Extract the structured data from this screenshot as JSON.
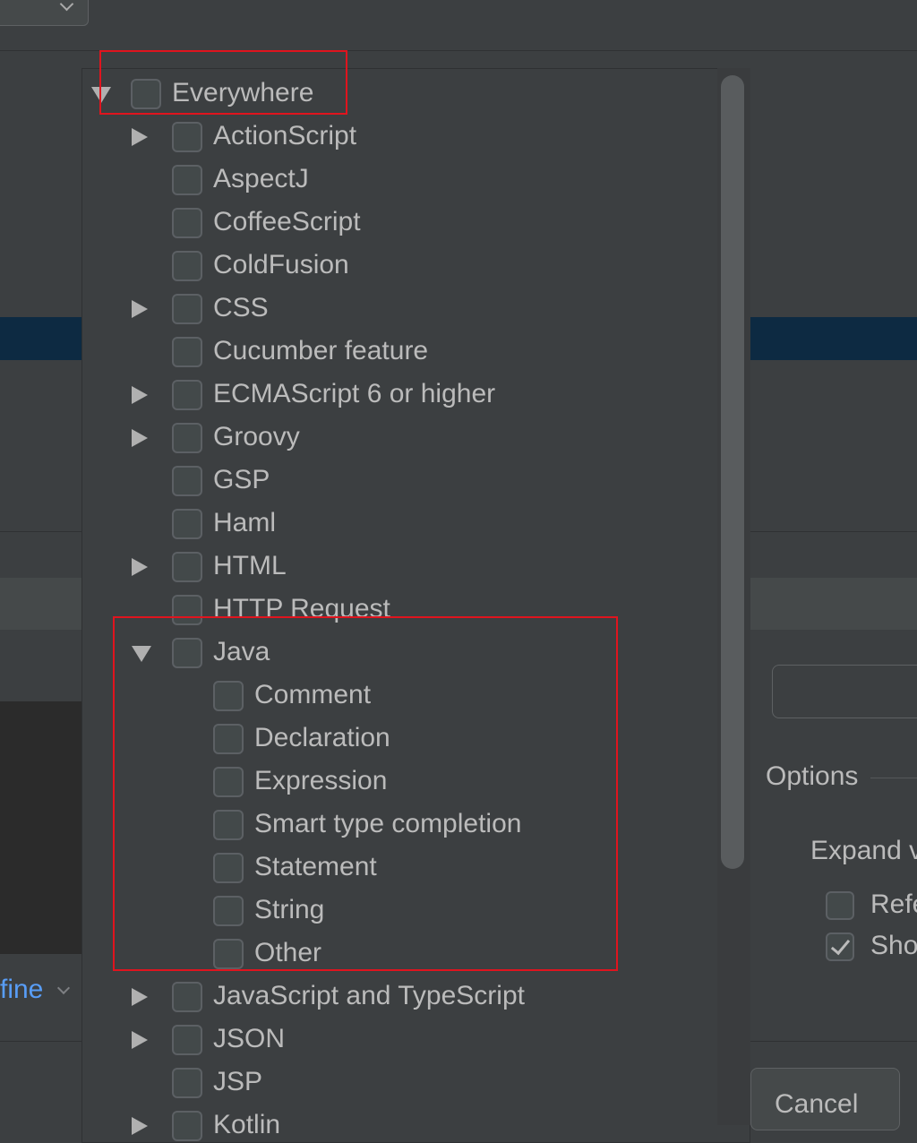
{
  "tree": {
    "root": {
      "label": "Everywhere",
      "expanded": true,
      "checked": false
    },
    "items": [
      {
        "label": "ActionScript",
        "level": 1,
        "expander": "collapsed",
        "checked": false
      },
      {
        "label": "AspectJ",
        "level": 1,
        "expander": "none",
        "checked": false
      },
      {
        "label": "CoffeeScript",
        "level": 1,
        "expander": "none",
        "checked": false
      },
      {
        "label": "ColdFusion",
        "level": 1,
        "expander": "none",
        "checked": false
      },
      {
        "label": "CSS",
        "level": 1,
        "expander": "collapsed",
        "checked": false
      },
      {
        "label": "Cucumber feature",
        "level": 1,
        "expander": "none",
        "checked": false
      },
      {
        "label": "ECMAScript 6 or higher",
        "level": 1,
        "expander": "collapsed",
        "checked": false
      },
      {
        "label": "Groovy",
        "level": 1,
        "expander": "collapsed",
        "checked": false
      },
      {
        "label": "GSP",
        "level": 1,
        "expander": "none",
        "checked": false
      },
      {
        "label": "Haml",
        "level": 1,
        "expander": "none",
        "checked": false
      },
      {
        "label": "HTML",
        "level": 1,
        "expander": "collapsed",
        "checked": false
      },
      {
        "label": "HTTP Request",
        "level": 1,
        "expander": "none",
        "checked": false
      },
      {
        "label": "Java",
        "level": 1,
        "expander": "expanded",
        "checked": false
      },
      {
        "label": "Comment",
        "level": 2,
        "expander": "none",
        "checked": false
      },
      {
        "label": "Declaration",
        "level": 2,
        "expander": "none",
        "checked": false
      },
      {
        "label": "Expression",
        "level": 2,
        "expander": "none",
        "checked": false
      },
      {
        "label": "Smart type completion",
        "level": 2,
        "expander": "none",
        "checked": false
      },
      {
        "label": "Statement",
        "level": 2,
        "expander": "none",
        "checked": false
      },
      {
        "label": "String",
        "level": 2,
        "expander": "none",
        "checked": false
      },
      {
        "label": "Other",
        "level": 2,
        "expander": "none",
        "checked": false
      },
      {
        "label": "JavaScript and TypeScript",
        "level": 1,
        "expander": "collapsed",
        "checked": false
      },
      {
        "label": "JSON",
        "level": 1,
        "expander": "collapsed",
        "checked": false
      },
      {
        "label": "JSP",
        "level": 1,
        "expander": "none",
        "checked": false
      },
      {
        "label": "Kotlin",
        "level": 1,
        "expander": "collapsed",
        "checked": false
      }
    ]
  },
  "background": {
    "define_link": "fine",
    "options_label": "Options",
    "expand_label": "Expand v",
    "option_1": {
      "label": "Refe",
      "checked": false
    },
    "option_2": {
      "label": "Sho",
      "checked": true
    },
    "cancel_label": "Cancel"
  },
  "colors": {
    "highlight": "#e0141e",
    "link": "#589df6",
    "selection_band": "#0d2a42"
  }
}
